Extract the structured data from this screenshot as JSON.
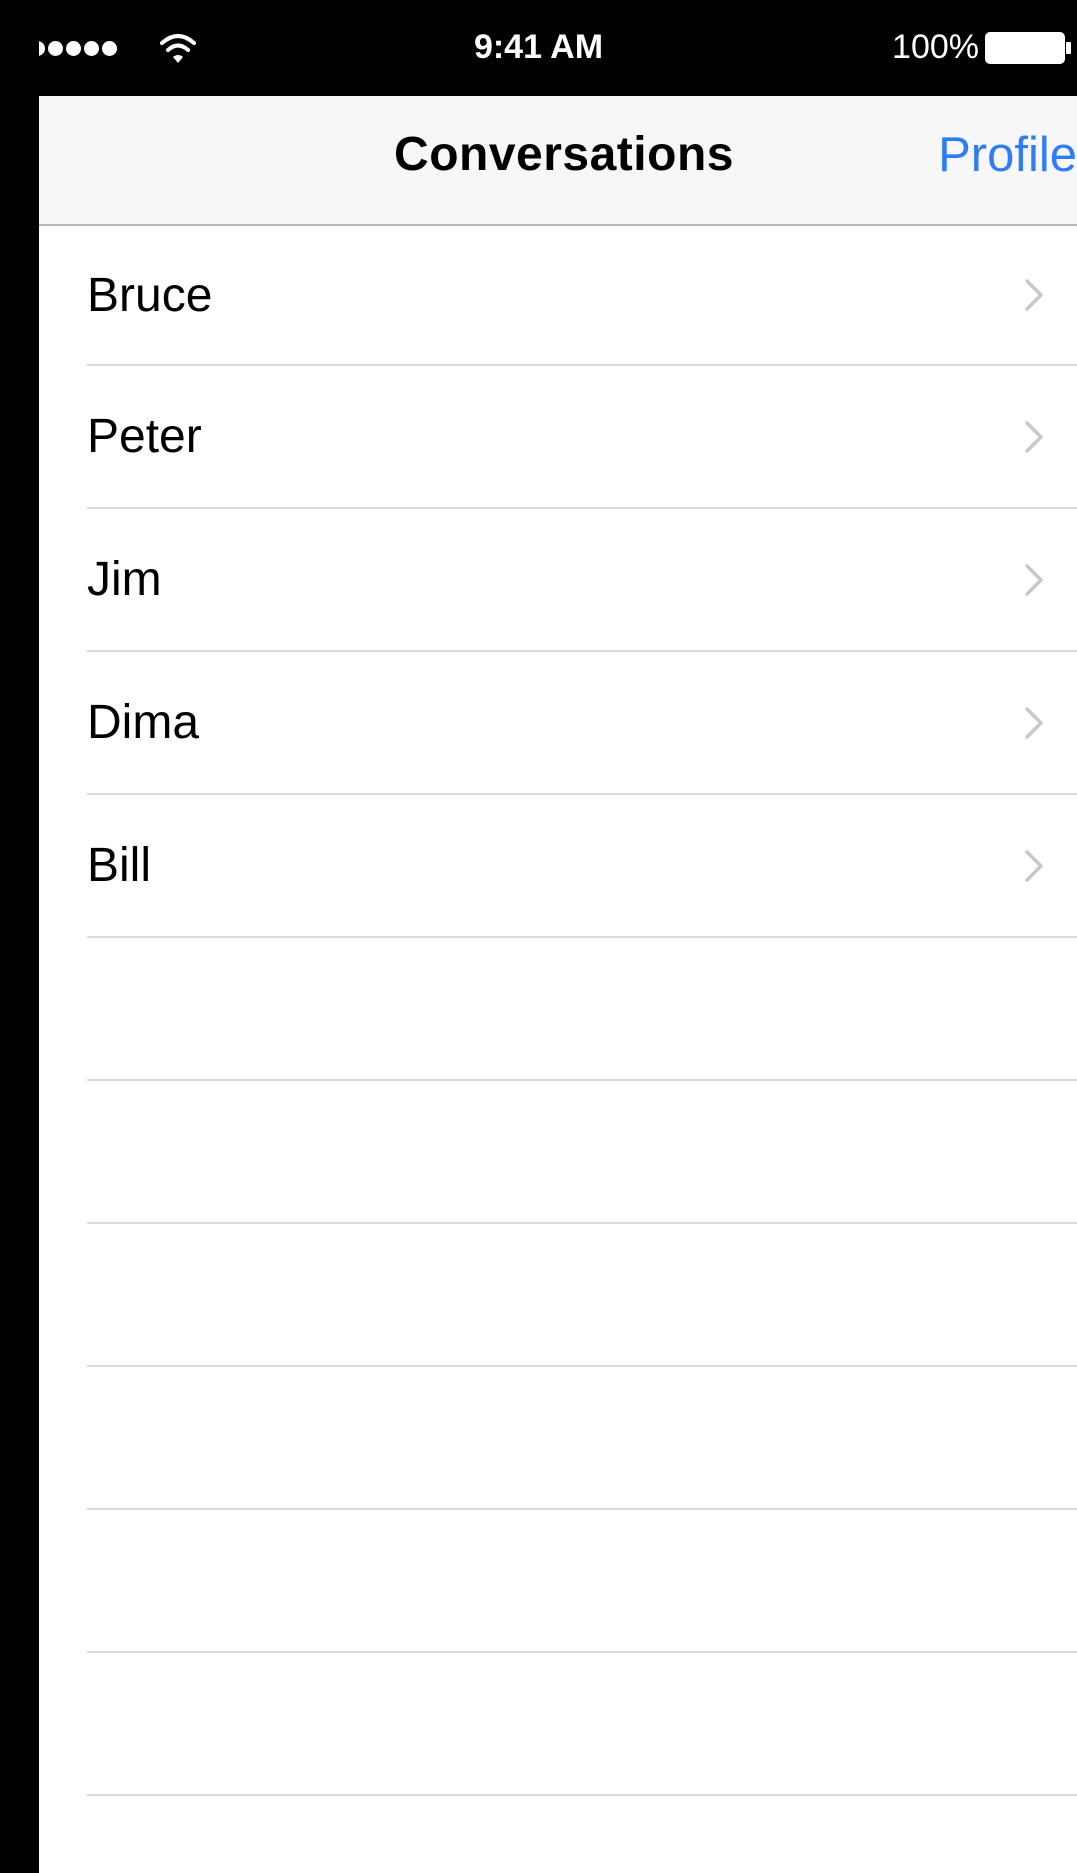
{
  "status_bar": {
    "time": "9:41 AM",
    "battery_percent": "100%",
    "signal_icon": "signal-dots-icon",
    "wifi_icon": "wifi-icon",
    "battery_icon": "battery-icon"
  },
  "nav": {
    "title": "Conversations",
    "right_button": "Profile",
    "accent_color": "#2f7cf6"
  },
  "conversations": [
    {
      "name": "Bruce",
      "icon": "chevron-right-icon"
    },
    {
      "name": "Peter",
      "icon": "chevron-right-icon"
    },
    {
      "name": "Jim",
      "icon": "chevron-right-icon"
    },
    {
      "name": "Dima",
      "icon": "chevron-right-icon"
    },
    {
      "name": "Bill",
      "icon": "chevron-right-icon"
    }
  ]
}
